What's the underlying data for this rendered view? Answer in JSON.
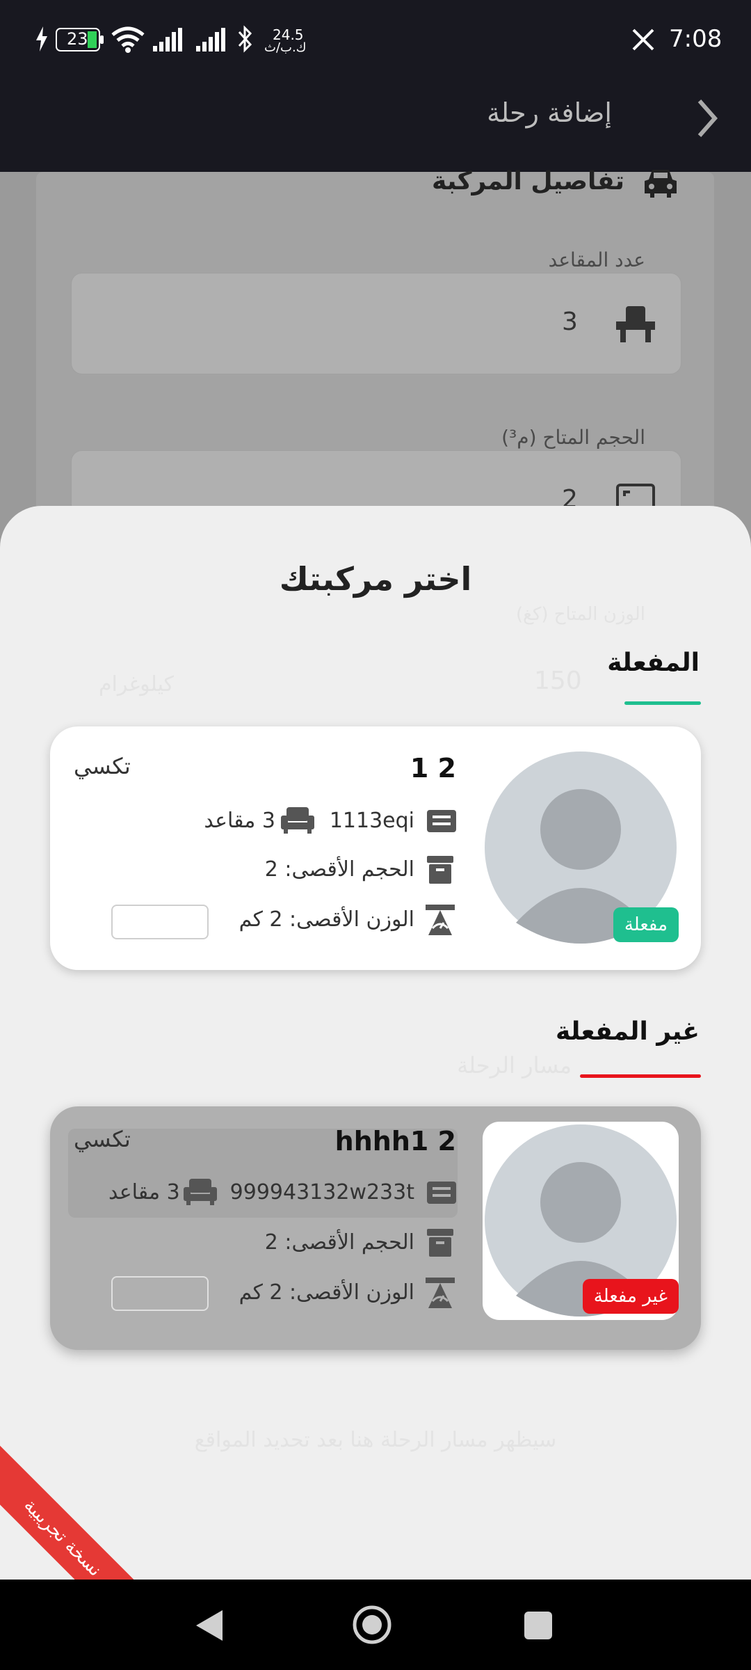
{
  "status_bar": {
    "battery": "23",
    "net_speed_value": "24.5",
    "net_speed_unit": "ك.ب/ث",
    "time": "7:08"
  },
  "app_bar": {
    "title": "إضافة رحلة"
  },
  "background": {
    "section_title": "تفاصيل المركبة",
    "seats_label": "عدد المقاعد",
    "seats_value": "3",
    "volume_label": "الحجم المتاح (م³)",
    "volume_value": "2",
    "weight_label": "الوزن المتاح (كغ)",
    "weight_value": "150",
    "weight_unit": "كيلوغرام",
    "route_label": "مسار الرحلة",
    "route_hint": "سيظهر مسار الرحلة هنا بعد تحديد المواقع"
  },
  "sheet": {
    "title": "اختر مركبتك",
    "active_section": "المفعلة",
    "inactive_section": "غير المفعلة",
    "vehicles": [
      {
        "name": "1 2",
        "type": "تكسي",
        "plate": "1113eqi",
        "seats": "3 مقاعد",
        "max_volume": "الحجم الأقصى: 2",
        "max_weight": "الوزن الأقصى: 2 كم",
        "status": "مفعلة"
      },
      {
        "name": "hhhh1 2",
        "type": "تكسي",
        "plate": "999943132w233t",
        "seats": "3 مقاعد",
        "max_volume": "الحجم الأقصى: 2",
        "max_weight": "الوزن الأقصى: 2 كم",
        "status": "غير مفعلة"
      }
    ]
  },
  "ribbon": "نسخة تجريبية",
  "colors": {
    "bar": "#181820",
    "active": "#1fbf8f",
    "inactive": "#e8141c"
  }
}
